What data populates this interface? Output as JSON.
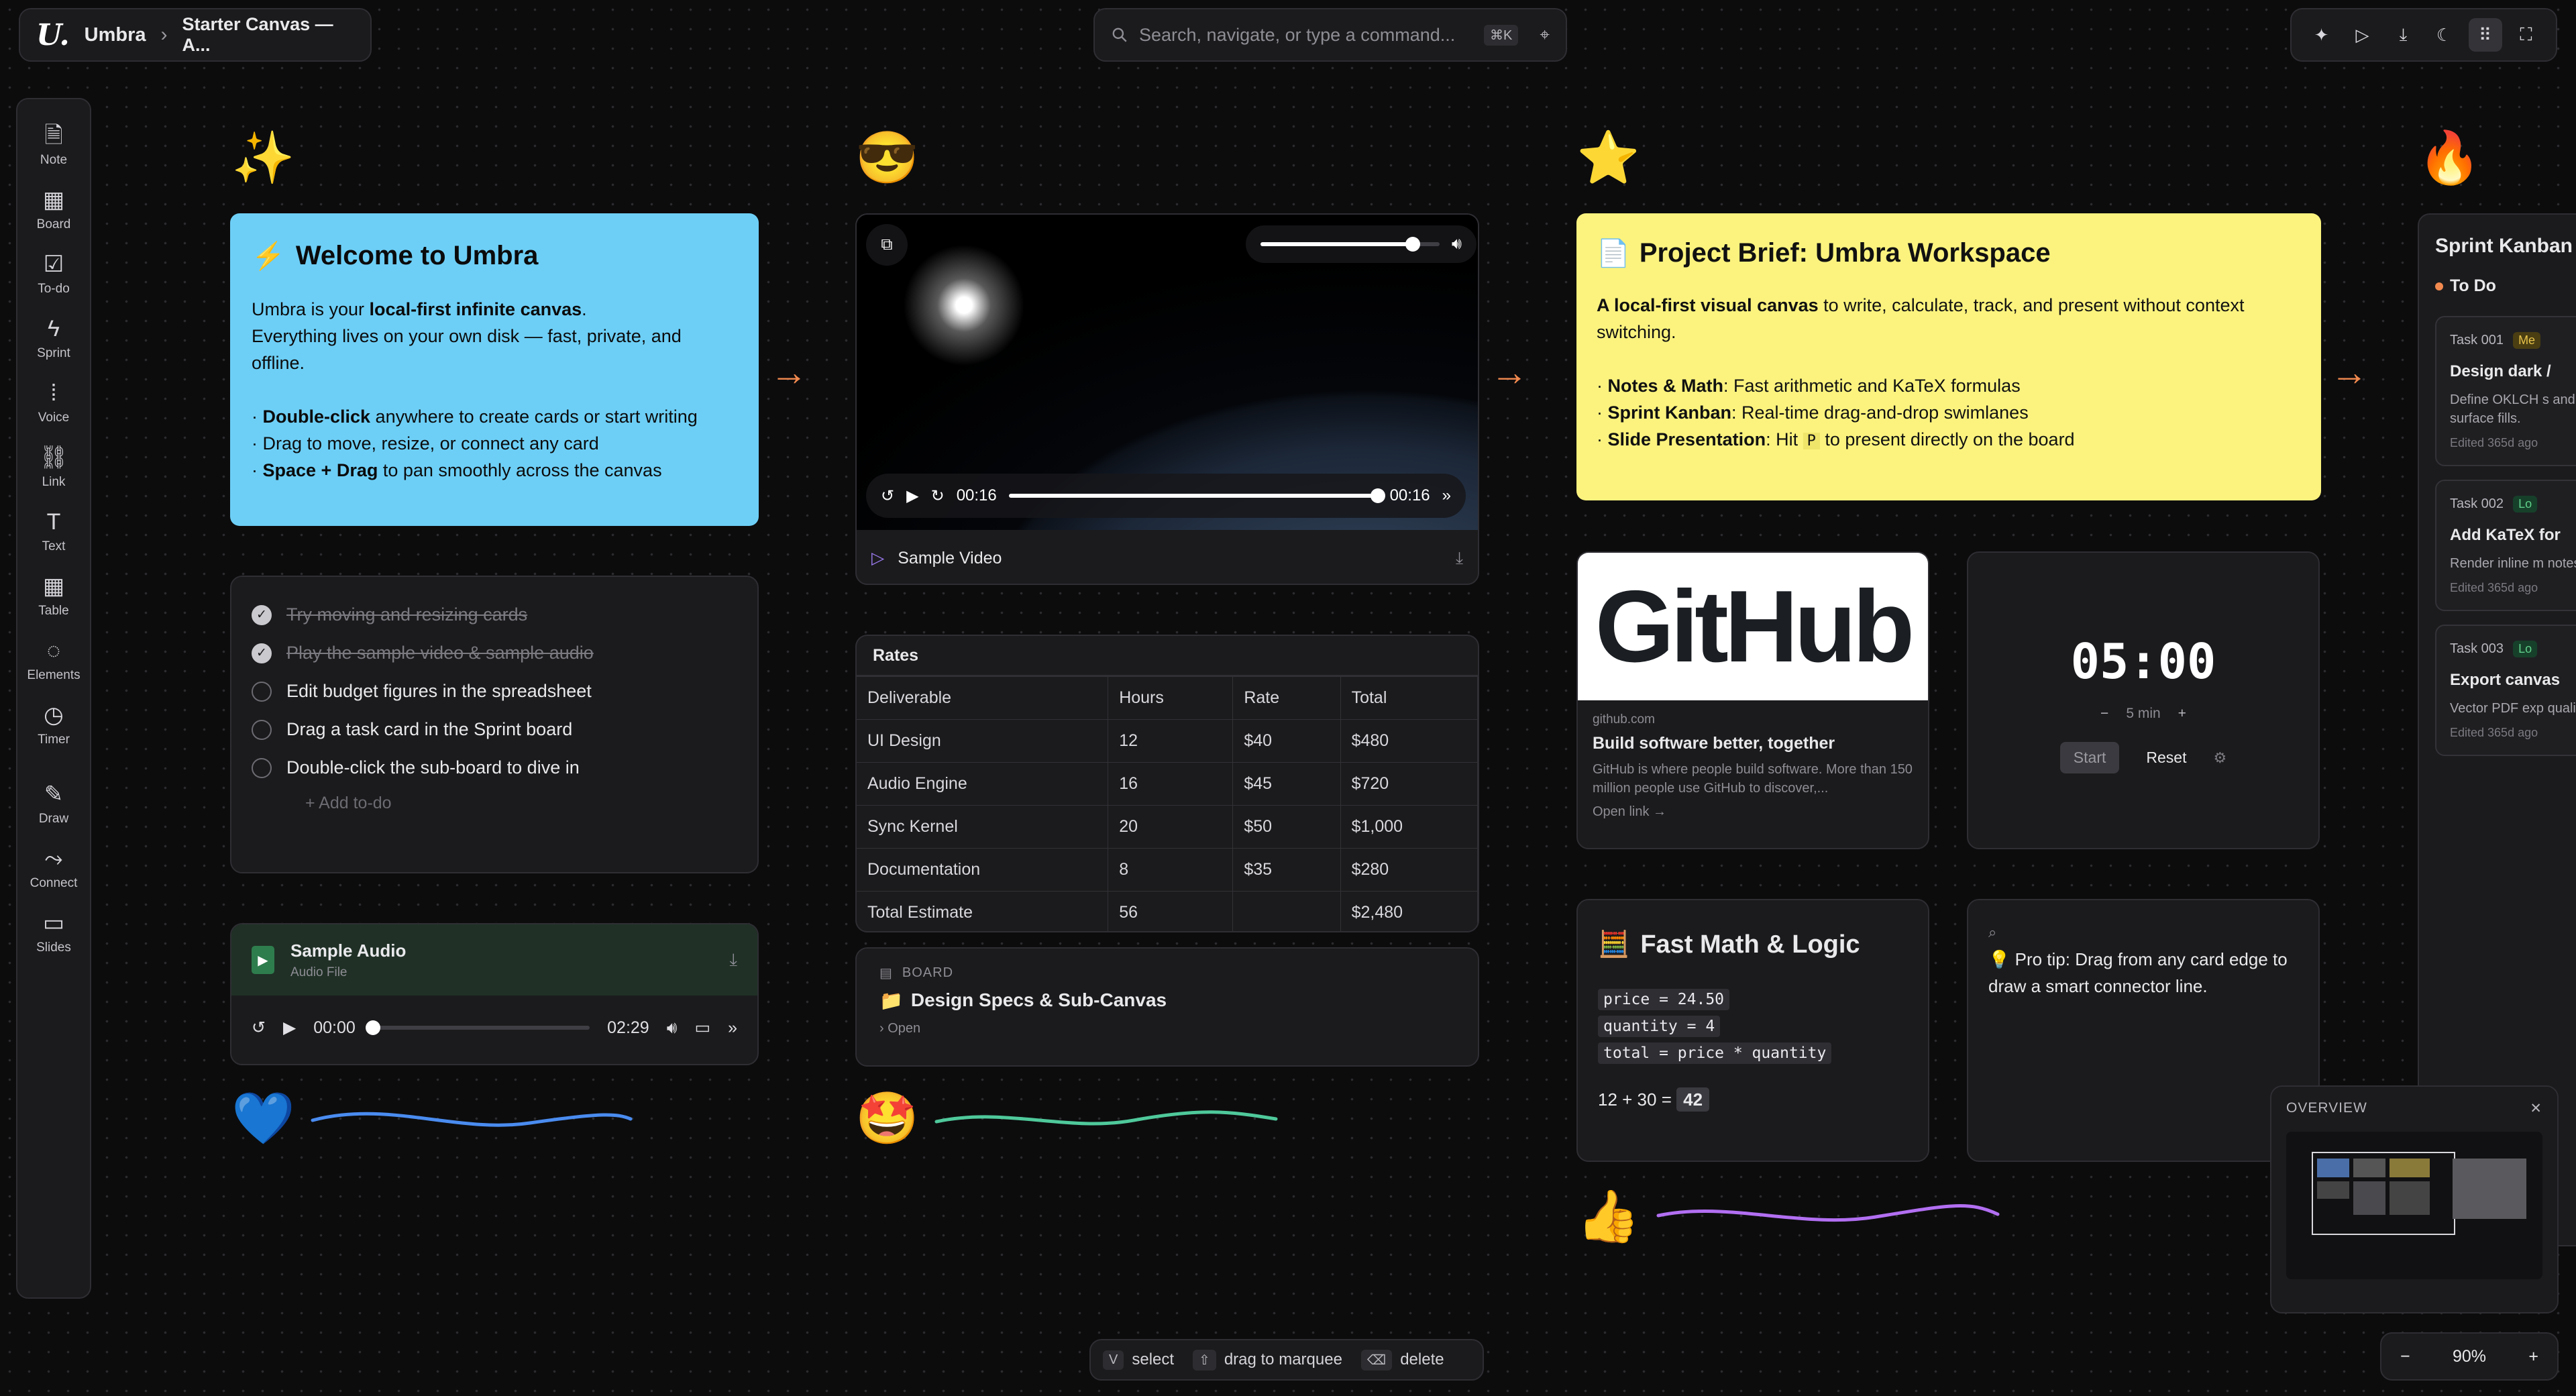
{
  "app": {
    "logo": "U.",
    "name": "Umbra",
    "crumb": "Starter Canvas — A..."
  },
  "search": {
    "placeholder": "Search, navigate, or type a command...",
    "shortcut": "⌘K"
  },
  "toolbar_icons": [
    "sparkle-icon",
    "play-icon",
    "download-icon",
    "moon-icon",
    "grid-icon",
    "fullscreen-icon"
  ],
  "sidebar": {
    "items": [
      {
        "label": "Note",
        "icon": "note-icon"
      },
      {
        "label": "Board",
        "icon": "board-icon"
      },
      {
        "label": "To-do",
        "icon": "todo-icon"
      },
      {
        "label": "Sprint",
        "icon": "sprint-icon"
      },
      {
        "label": "Voice",
        "icon": "voice-icon"
      },
      {
        "label": "Link",
        "icon": "link-icon"
      },
      {
        "label": "Text",
        "icon": "text-icon"
      },
      {
        "label": "Table",
        "icon": "table-icon"
      },
      {
        "label": "Elements",
        "icon": "elements-icon"
      },
      {
        "label": "Timer",
        "icon": "timer-icon"
      },
      {
        "label": "Draw",
        "icon": "draw-icon"
      },
      {
        "label": "Connect",
        "icon": "connect-icon"
      },
      {
        "label": "Slides",
        "icon": "slides-icon"
      }
    ]
  },
  "emojis": {
    "sparkles": "✨",
    "sunglasses": "😎",
    "star": "⭐",
    "fire": "🔥",
    "heart": "💙",
    "starstruck": "🤩",
    "thumbs": "👍"
  },
  "welcome": {
    "icon": "⚡",
    "title": "Welcome to Umbra",
    "p1a": "Umbra is your ",
    "p1b": "local-first infinite canvas",
    "p1c": ".",
    "p2": "Everything lives on your own disk — fast, private, and offline.",
    "b1a": "· ",
    "b1b": "Double-click",
    "b1c": " anywhere to create cards or start writing",
    "b2": "· Drag to move, resize, or connect any card",
    "b3a": "· ",
    "b3b": "Space + Drag",
    "b3c": " to pan smoothly across the canvas"
  },
  "todo": {
    "items": [
      {
        "text": "Try moving and resizing cards",
        "done": true
      },
      {
        "text": "Play the sample video & sample audio",
        "done": true
      },
      {
        "text": "Edit budget figures in the spreadsheet",
        "done": false
      },
      {
        "text": "Drag a task card in the Sprint board",
        "done": false
      },
      {
        "text": "Double-click the sub-board to dive in",
        "done": false
      }
    ],
    "add_label": "+ Add to-do"
  },
  "audio": {
    "title": "Sample Audio",
    "subtitle": "Audio File",
    "current": "00:00",
    "duration": "02:29",
    "progress": 0.0
  },
  "video": {
    "title": "Sample Video",
    "current": "00:16",
    "duration": "00:16",
    "progress": 1.0,
    "volume": 0.85
  },
  "rates": {
    "title": "Rates",
    "headers": [
      "Deliverable",
      "Hours",
      "Rate",
      "Total"
    ],
    "rows": [
      [
        "UI Design",
        "12",
        "$40",
        "$480"
      ],
      [
        "Audio Engine",
        "16",
        "$45",
        "$720"
      ],
      [
        "Sync Kernel",
        "20",
        "$50",
        "$1,000"
      ],
      [
        "Documentation",
        "8",
        "$35",
        "$280"
      ],
      [
        "Total Estimate",
        "56",
        "",
        "$2,480"
      ]
    ]
  },
  "board_card": {
    "caption": "BOARD",
    "icon": "📁",
    "title": "Design Specs & Sub-Canvas",
    "open": "› Open"
  },
  "brief": {
    "icon": "📄",
    "title": "Project Brief: Umbra Workspace",
    "p1a": "A local-first visual canvas",
    "p1b": " to write, calculate, track, and present without context switching.",
    "l1a": "Notes & Math",
    "l1b": ": Fast arithmetic and KaTeX formulas",
    "l2a": "Sprint Kanban",
    "l2b": ": Real-time drag-and-drop swimlanes",
    "l3a": "Slide Presentation",
    "l3b": ": Hit ",
    "l3key": "P",
    "l3c": " to present directly on the board"
  },
  "github": {
    "banner": "GitHub",
    "domain": "github.com",
    "title": "Build software better, together",
    "desc": "GitHub is where people build software. More than 150 million people use GitHub to discover,...",
    "open": "Open link →"
  },
  "timer": {
    "display": "05:00",
    "minus": "−",
    "step": "5 min",
    "plus": "+",
    "start": "Start",
    "reset": "Reset"
  },
  "math": {
    "icon": "🧮",
    "title": "Fast Math & Logic",
    "lines": [
      "price = 24.50",
      "quantity = 4",
      "total = price * quantity"
    ],
    "expr": "12 + 30 =",
    "result": "42"
  },
  "tip": {
    "icon": "💡",
    "text": "Pro tip: Drag from any card edge to draw a smart connector line."
  },
  "kanban": {
    "title": "Sprint Kanban",
    "column": "To Do",
    "cards": [
      {
        "id": "Task 001",
        "tag": "Me",
        "title": "Design dark /",
        "desc": "Define OKLCH s and surface fills.",
        "edited": "Edited 365d ago"
      },
      {
        "id": "Task 002",
        "tag": "Lo",
        "title": "Add KaTeX for",
        "desc": "Render inline m notes.",
        "edited": "Edited 365d ago"
      },
      {
        "id": "Task 003",
        "tag": "Lo",
        "title": "Export canvas",
        "desc": "Vector PDF exp quality.",
        "edited": "Edited 365d ago"
      }
    ]
  },
  "overview": {
    "title": "OVERVIEW"
  },
  "hints": [
    {
      "key": "V",
      "label": "select"
    },
    {
      "key": "⇧",
      "label": "drag to marquee"
    },
    {
      "key": "⌫",
      "label": "delete"
    }
  ],
  "zoom": {
    "minus": "−",
    "level": "90%",
    "plus": "+"
  },
  "colors": {
    "accent_blue": "#6dcff6",
    "accent_yellow": "#fbf37e",
    "arrow": "#f28a4f",
    "todo_dot": "#f28a4f"
  }
}
